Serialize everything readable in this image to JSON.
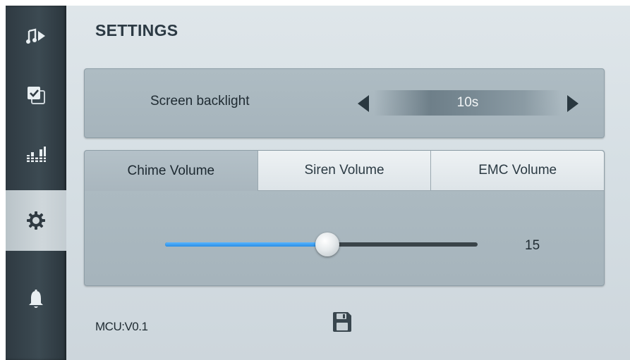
{
  "page": {
    "title": "SETTINGS",
    "version_text": "MCU:V0.1"
  },
  "sidebar": {
    "items": [
      {
        "icon": "music-play-icon",
        "active": false
      },
      {
        "icon": "checklist-icon",
        "active": false
      },
      {
        "icon": "equalizer-icon",
        "active": false
      },
      {
        "icon": "gear-icon",
        "active": true
      },
      {
        "icon": "bell-icon",
        "active": false
      }
    ]
  },
  "backlight": {
    "label": "Screen backlight",
    "value": "10s",
    "left_icon": "arrow-left-icon",
    "right_icon": "arrow-right-icon"
  },
  "volume": {
    "tabs": [
      {
        "label": "Chime Volume",
        "active": true
      },
      {
        "label": "Siren Volume",
        "active": false
      },
      {
        "label": "EMC Volume",
        "active": false
      }
    ],
    "value": "15",
    "slider_fraction": 0.52
  },
  "footer": {
    "save_icon": "save-icon"
  },
  "colors": {
    "accent": "#2a8fe6",
    "sidebar_bg": "#3c4a52",
    "panel_bg": "#a6b4bc",
    "text_dark": "#1f2b32"
  }
}
